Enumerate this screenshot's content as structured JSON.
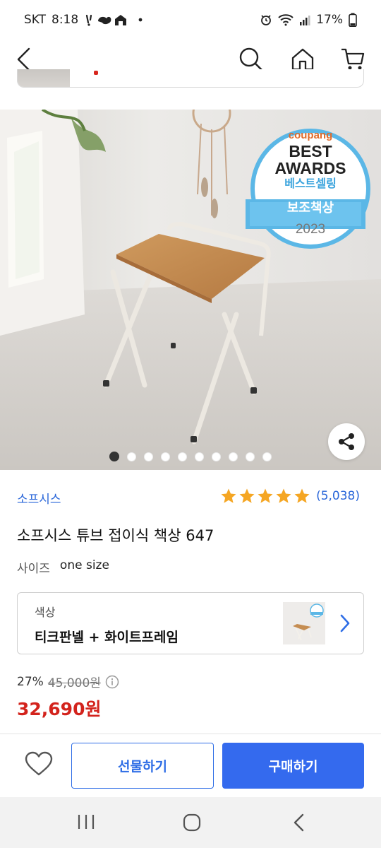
{
  "status_bar": {
    "carrier": "SKT",
    "time": "8:18",
    "battery": "17%"
  },
  "nav": {
    "back_icon": "back-arrow-icon",
    "search_icon": "search-icon",
    "home_icon": "home-icon",
    "cart_icon": "cart-icon"
  },
  "hero": {
    "badge": {
      "brand": "coupang",
      "line1": "BEST",
      "line2": "AWARDS",
      "line3": "베스트셀링",
      "ribbon": "보조책상",
      "year": "2023"
    },
    "dot_count": 10,
    "active_dot": 0
  },
  "product": {
    "brand": "소프시스",
    "rating_stars": 5,
    "review_count": "(5,038)",
    "title": "소프시스 튜브 접이식 책상 647",
    "size_label": "사이즈",
    "size_value": "one size",
    "option": {
      "label": "색상",
      "value": "티크판넬 + 화이트프레임"
    },
    "discount": "27%",
    "original_price": "45,000원",
    "price": "32,690원"
  },
  "actions": {
    "gift": "선물하기",
    "buy": "구매하기"
  },
  "colors": {
    "accent": "#346aee",
    "price": "#d3231c",
    "star": "#f5a623",
    "brand_link": "#2966d9"
  }
}
